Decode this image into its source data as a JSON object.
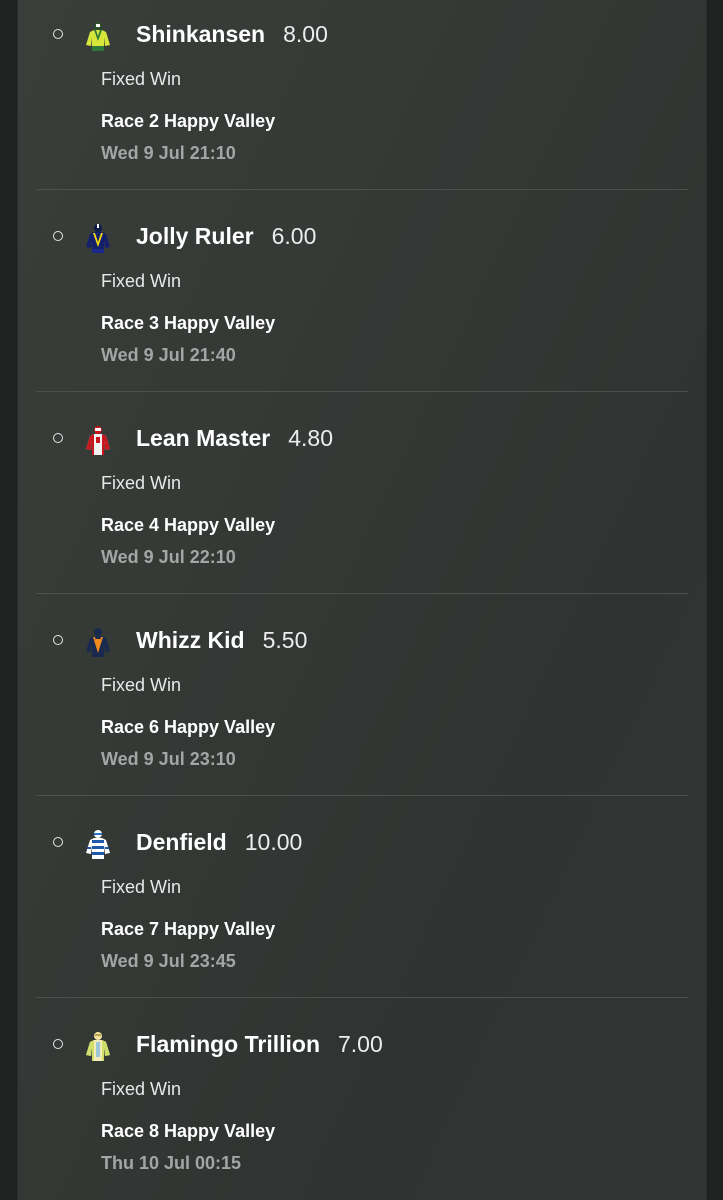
{
  "bets": [
    {
      "horse": "Shinkansen",
      "odds": "8.00",
      "bet_type": "Fixed Win",
      "race": "Race 2 Happy Valley",
      "time": "Wed 9 Jul 21:10",
      "silk_icon": "jockey-silk-yellow-green-icon"
    },
    {
      "horse": "Jolly Ruler",
      "odds": "6.00",
      "bet_type": "Fixed Win",
      "race": "Race 3 Happy Valley",
      "time": "Wed 9 Jul 21:40",
      "silk_icon": "jockey-silk-navy-yellow-icon"
    },
    {
      "horse": "Lean Master",
      "odds": "4.80",
      "bet_type": "Fixed Win",
      "race": "Race 4 Happy Valley",
      "time": "Wed 9 Jul 22:10",
      "silk_icon": "jockey-silk-red-white-icon"
    },
    {
      "horse": "Whizz Kid",
      "odds": "5.50",
      "bet_type": "Fixed Win",
      "race": "Race 6 Happy Valley",
      "time": "Wed 9 Jul 23:10",
      "silk_icon": "jockey-silk-navy-orange-icon"
    },
    {
      "horse": "Denfield",
      "odds": "10.00",
      "bet_type": "Fixed Win",
      "race": "Race 7 Happy Valley",
      "time": "Wed 9 Jul 23:45",
      "silk_icon": "jockey-silk-blue-white-hoops-icon"
    },
    {
      "horse": "Flamingo Trillion",
      "odds": "7.00",
      "bet_type": "Fixed Win",
      "race": "Race 8 Happy Valley",
      "time": "Thu 10 Jul 00:15",
      "silk_icon": "jockey-silk-yellow-white-icon"
    }
  ]
}
